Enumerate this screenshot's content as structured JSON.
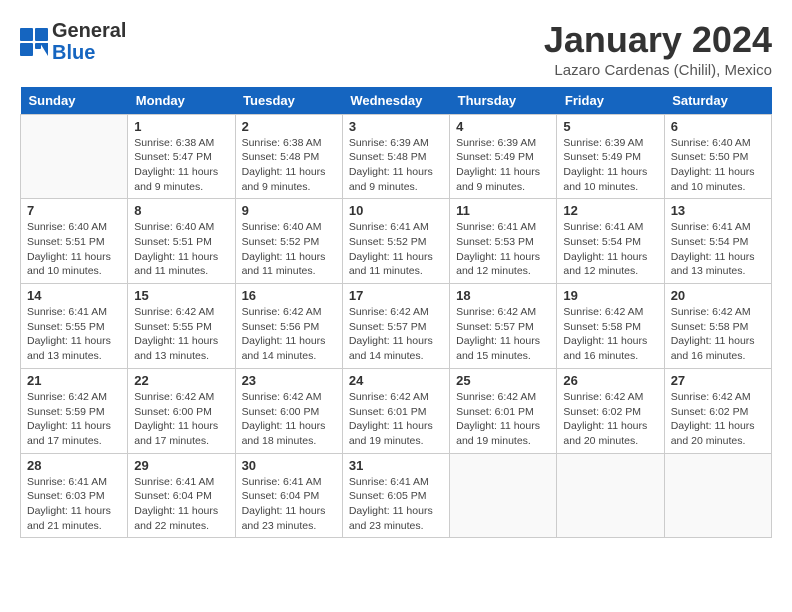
{
  "logo": {
    "general": "General",
    "blue": "Blue"
  },
  "title": "January 2024",
  "location": "Lazaro Cardenas (Chilil), Mexico",
  "weekdays": [
    "Sunday",
    "Monday",
    "Tuesday",
    "Wednesday",
    "Thursday",
    "Friday",
    "Saturday"
  ],
  "weeks": [
    [
      {
        "day": "",
        "sunrise": "",
        "sunset": "",
        "daylight": ""
      },
      {
        "day": "1",
        "sunrise": "Sunrise: 6:38 AM",
        "sunset": "Sunset: 5:47 PM",
        "daylight": "Daylight: 11 hours and 9 minutes."
      },
      {
        "day": "2",
        "sunrise": "Sunrise: 6:38 AM",
        "sunset": "Sunset: 5:48 PM",
        "daylight": "Daylight: 11 hours and 9 minutes."
      },
      {
        "day": "3",
        "sunrise": "Sunrise: 6:39 AM",
        "sunset": "Sunset: 5:48 PM",
        "daylight": "Daylight: 11 hours and 9 minutes."
      },
      {
        "day": "4",
        "sunrise": "Sunrise: 6:39 AM",
        "sunset": "Sunset: 5:49 PM",
        "daylight": "Daylight: 11 hours and 9 minutes."
      },
      {
        "day": "5",
        "sunrise": "Sunrise: 6:39 AM",
        "sunset": "Sunset: 5:49 PM",
        "daylight": "Daylight: 11 hours and 10 minutes."
      },
      {
        "day": "6",
        "sunrise": "Sunrise: 6:40 AM",
        "sunset": "Sunset: 5:50 PM",
        "daylight": "Daylight: 11 hours and 10 minutes."
      }
    ],
    [
      {
        "day": "7",
        "sunrise": "Sunrise: 6:40 AM",
        "sunset": "Sunset: 5:51 PM",
        "daylight": "Daylight: 11 hours and 10 minutes."
      },
      {
        "day": "8",
        "sunrise": "Sunrise: 6:40 AM",
        "sunset": "Sunset: 5:51 PM",
        "daylight": "Daylight: 11 hours and 11 minutes."
      },
      {
        "day": "9",
        "sunrise": "Sunrise: 6:40 AM",
        "sunset": "Sunset: 5:52 PM",
        "daylight": "Daylight: 11 hours and 11 minutes."
      },
      {
        "day": "10",
        "sunrise": "Sunrise: 6:41 AM",
        "sunset": "Sunset: 5:52 PM",
        "daylight": "Daylight: 11 hours and 11 minutes."
      },
      {
        "day": "11",
        "sunrise": "Sunrise: 6:41 AM",
        "sunset": "Sunset: 5:53 PM",
        "daylight": "Daylight: 11 hours and 12 minutes."
      },
      {
        "day": "12",
        "sunrise": "Sunrise: 6:41 AM",
        "sunset": "Sunset: 5:54 PM",
        "daylight": "Daylight: 11 hours and 12 minutes."
      },
      {
        "day": "13",
        "sunrise": "Sunrise: 6:41 AM",
        "sunset": "Sunset: 5:54 PM",
        "daylight": "Daylight: 11 hours and 13 minutes."
      }
    ],
    [
      {
        "day": "14",
        "sunrise": "Sunrise: 6:41 AM",
        "sunset": "Sunset: 5:55 PM",
        "daylight": "Daylight: 11 hours and 13 minutes."
      },
      {
        "day": "15",
        "sunrise": "Sunrise: 6:42 AM",
        "sunset": "Sunset: 5:55 PM",
        "daylight": "Daylight: 11 hours and 13 minutes."
      },
      {
        "day": "16",
        "sunrise": "Sunrise: 6:42 AM",
        "sunset": "Sunset: 5:56 PM",
        "daylight": "Daylight: 11 hours and 14 minutes."
      },
      {
        "day": "17",
        "sunrise": "Sunrise: 6:42 AM",
        "sunset": "Sunset: 5:57 PM",
        "daylight": "Daylight: 11 hours and 14 minutes."
      },
      {
        "day": "18",
        "sunrise": "Sunrise: 6:42 AM",
        "sunset": "Sunset: 5:57 PM",
        "daylight": "Daylight: 11 hours and 15 minutes."
      },
      {
        "day": "19",
        "sunrise": "Sunrise: 6:42 AM",
        "sunset": "Sunset: 5:58 PM",
        "daylight": "Daylight: 11 hours and 16 minutes."
      },
      {
        "day": "20",
        "sunrise": "Sunrise: 6:42 AM",
        "sunset": "Sunset: 5:58 PM",
        "daylight": "Daylight: 11 hours and 16 minutes."
      }
    ],
    [
      {
        "day": "21",
        "sunrise": "Sunrise: 6:42 AM",
        "sunset": "Sunset: 5:59 PM",
        "daylight": "Daylight: 11 hours and 17 minutes."
      },
      {
        "day": "22",
        "sunrise": "Sunrise: 6:42 AM",
        "sunset": "Sunset: 6:00 PM",
        "daylight": "Daylight: 11 hours and 17 minutes."
      },
      {
        "day": "23",
        "sunrise": "Sunrise: 6:42 AM",
        "sunset": "Sunset: 6:00 PM",
        "daylight": "Daylight: 11 hours and 18 minutes."
      },
      {
        "day": "24",
        "sunrise": "Sunrise: 6:42 AM",
        "sunset": "Sunset: 6:01 PM",
        "daylight": "Daylight: 11 hours and 19 minutes."
      },
      {
        "day": "25",
        "sunrise": "Sunrise: 6:42 AM",
        "sunset": "Sunset: 6:01 PM",
        "daylight": "Daylight: 11 hours and 19 minutes."
      },
      {
        "day": "26",
        "sunrise": "Sunrise: 6:42 AM",
        "sunset": "Sunset: 6:02 PM",
        "daylight": "Daylight: 11 hours and 20 minutes."
      },
      {
        "day": "27",
        "sunrise": "Sunrise: 6:42 AM",
        "sunset": "Sunset: 6:02 PM",
        "daylight": "Daylight: 11 hours and 20 minutes."
      }
    ],
    [
      {
        "day": "28",
        "sunrise": "Sunrise: 6:41 AM",
        "sunset": "Sunset: 6:03 PM",
        "daylight": "Daylight: 11 hours and 21 minutes."
      },
      {
        "day": "29",
        "sunrise": "Sunrise: 6:41 AM",
        "sunset": "Sunset: 6:04 PM",
        "daylight": "Daylight: 11 hours and 22 minutes."
      },
      {
        "day": "30",
        "sunrise": "Sunrise: 6:41 AM",
        "sunset": "Sunset: 6:04 PM",
        "daylight": "Daylight: 11 hours and 23 minutes."
      },
      {
        "day": "31",
        "sunrise": "Sunrise: 6:41 AM",
        "sunset": "Sunset: 6:05 PM",
        "daylight": "Daylight: 11 hours and 23 minutes."
      },
      {
        "day": "",
        "sunrise": "",
        "sunset": "",
        "daylight": ""
      },
      {
        "day": "",
        "sunrise": "",
        "sunset": "",
        "daylight": ""
      },
      {
        "day": "",
        "sunrise": "",
        "sunset": "",
        "daylight": ""
      }
    ]
  ]
}
